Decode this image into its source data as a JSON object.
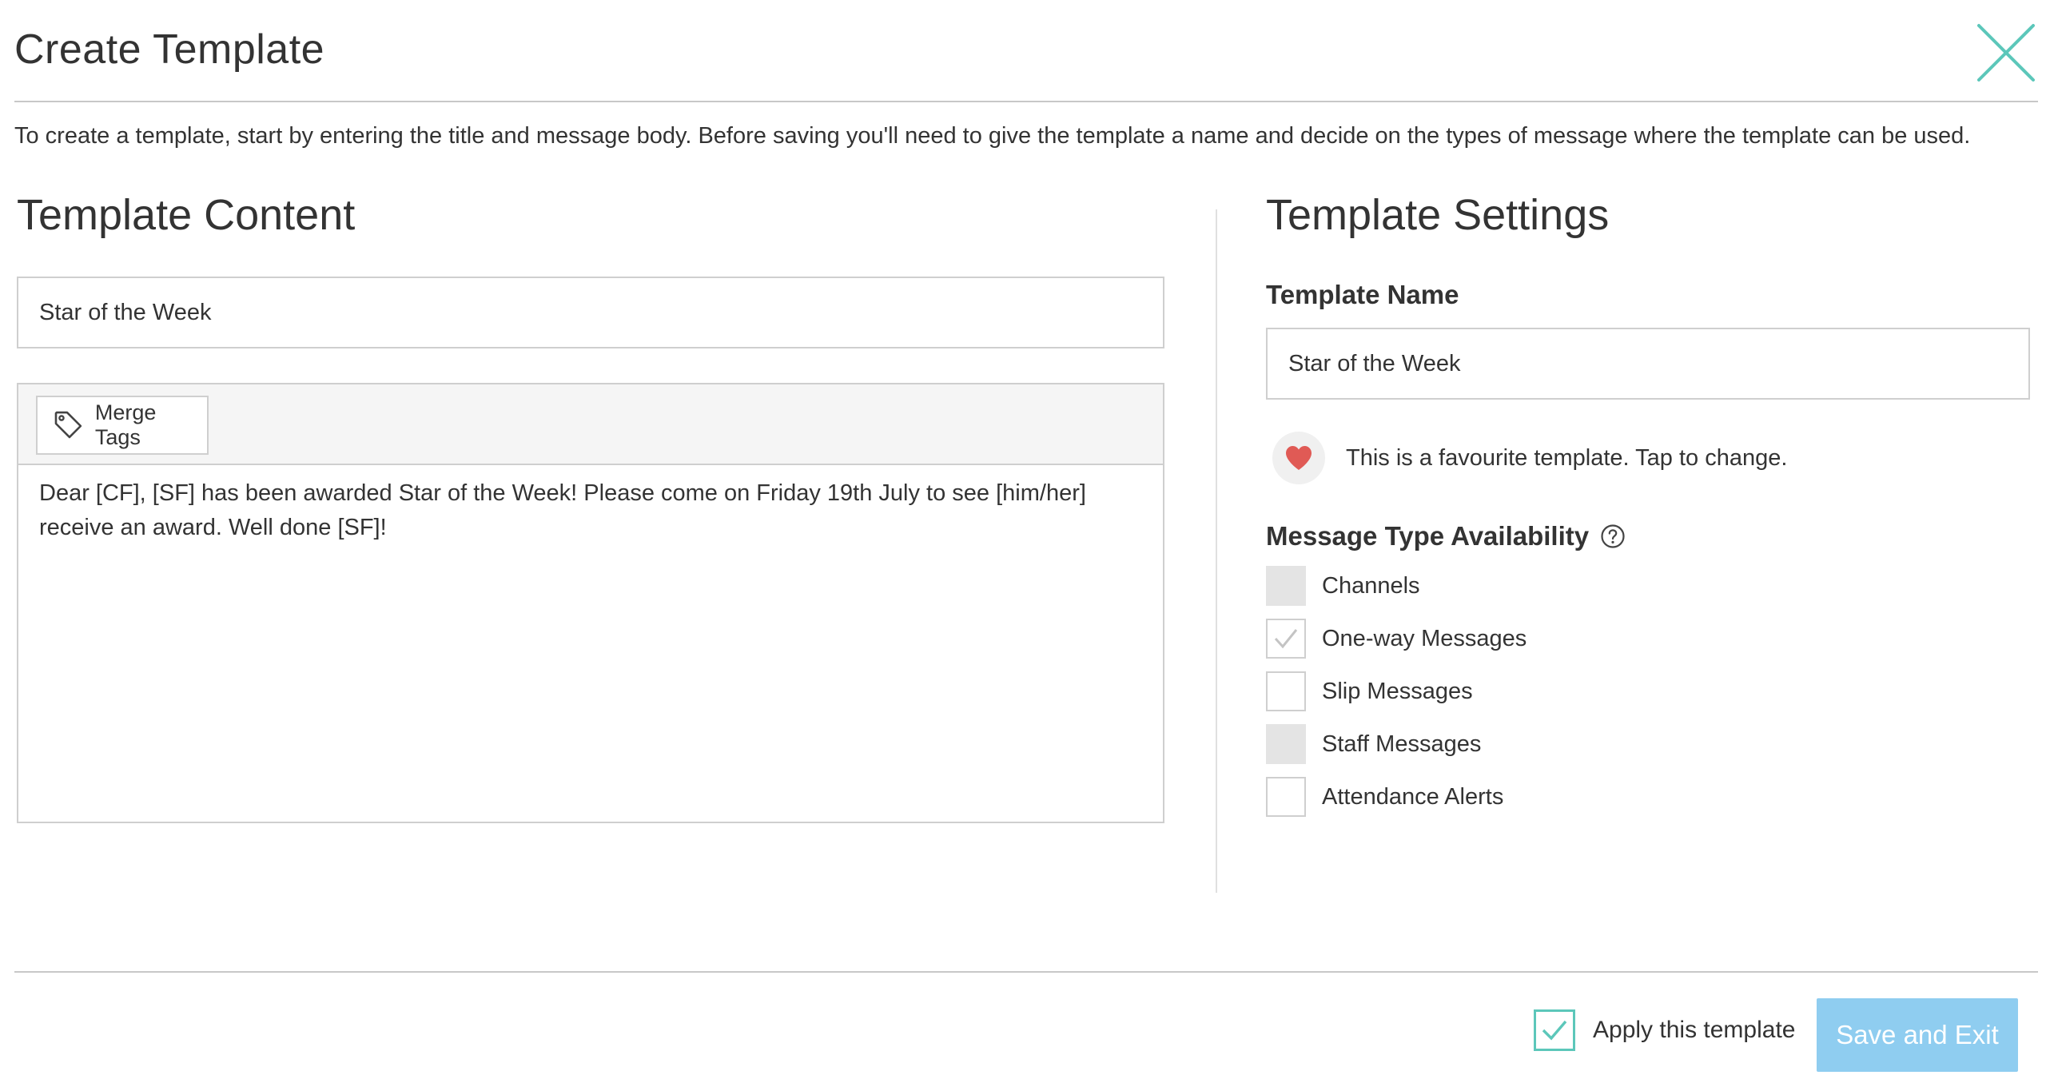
{
  "dialog": {
    "title": "Create Template",
    "intro": "To create a template, start by entering the title and message body. Before saving you'll need to give the template a name and decide on the types of message where the template can be used."
  },
  "content": {
    "heading": "Template Content",
    "title_value": "Star of the Week",
    "merge_tags_label": "Merge Tags",
    "body_text": "Dear [CF], [SF] has been awarded Star of the Week! Please come on Friday 19th July to see [him/her] receive an award. Well done [SF]!"
  },
  "settings": {
    "heading": "Template Settings",
    "name_label": "Template Name",
    "name_value": "Star of the Week",
    "favourite_text": "This is a favourite template. Tap to change.",
    "availability_label": "Message Type Availability",
    "message_types": [
      {
        "label": "Channels",
        "state": "disabled"
      },
      {
        "label": "One-way Messages",
        "state": "checked"
      },
      {
        "label": "Slip Messages",
        "state": "unchecked"
      },
      {
        "label": "Staff Messages",
        "state": "disabled"
      },
      {
        "label": "Attendance Alerts",
        "state": "unchecked"
      }
    ]
  },
  "footer": {
    "apply_label": "Apply this template",
    "apply_checked": true,
    "save_label": "Save and Exit"
  },
  "colors": {
    "accent_teal": "#5cc7ba",
    "save_button": "#8fcdf0",
    "heart": "#e05a55",
    "disabled_box": "#e4e4e4"
  },
  "icons": {
    "close": "close-icon",
    "merge_tags": "tag-icon",
    "favourite": "heart-icon",
    "help": "question-circle-icon",
    "check": "checkmark-icon"
  }
}
